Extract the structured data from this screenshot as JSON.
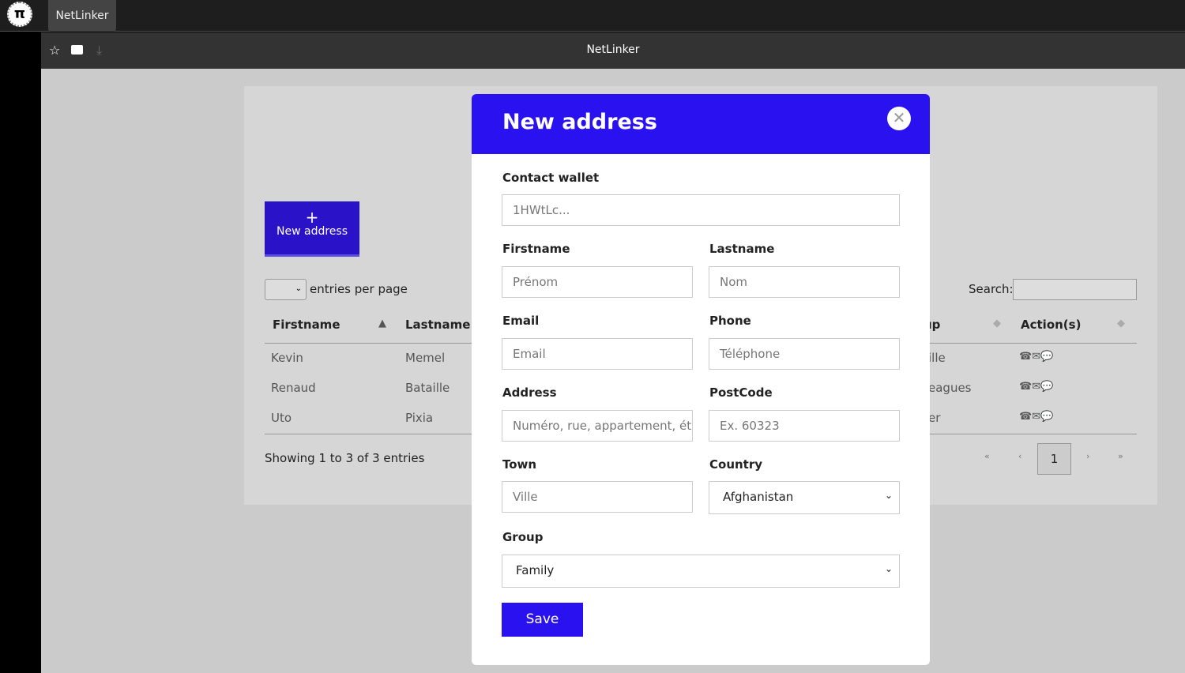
{
  "browser": {
    "tab": "NetLinker",
    "title": "NetLinker",
    "logo": "π"
  },
  "page": {
    "new_button": {
      "icon": "+",
      "label": "New address"
    },
    "entries_label": "entries per page",
    "search_label": "Search:",
    "columns": [
      "Firstname",
      "Lastname",
      "up",
      "Action(s)"
    ],
    "rows": [
      {
        "firstname": "Kevin",
        "lastname": "Memel",
        "group": "ille"
      },
      {
        "firstname": "Renaud",
        "lastname": "Bataille",
        "group": "eagues"
      },
      {
        "firstname": "Uto",
        "lastname": "Pixia",
        "group": "er"
      }
    ],
    "info": "Showing 1 to 3 of 3 entries",
    "pagination": {
      "first": "«",
      "prev": "‹",
      "current": "1",
      "next": "›",
      "last": "»"
    }
  },
  "modal": {
    "title": "New address",
    "close": "✕",
    "wallet_label": "Contact wallet",
    "wallet_value": "1HWtLc...",
    "firstname_label": "Firstname",
    "firstname_ph": "Prénom",
    "lastname_label": "Lastname",
    "lastname_ph": "Nom",
    "email_label": "Email",
    "email_ph": "Email",
    "phone_label": "Phone",
    "phone_ph": "Téléphone",
    "address_label": "Address",
    "address_ph": "Numéro, rue, appartement, étage",
    "postcode_label": "PostCode",
    "postcode_ph": "Ex. 60323",
    "town_label": "Town",
    "town_ph": "Ville",
    "country_label": "Country",
    "country_value": "Afghanistan",
    "group_label": "Group",
    "group_value": "Family",
    "save": "Save"
  }
}
